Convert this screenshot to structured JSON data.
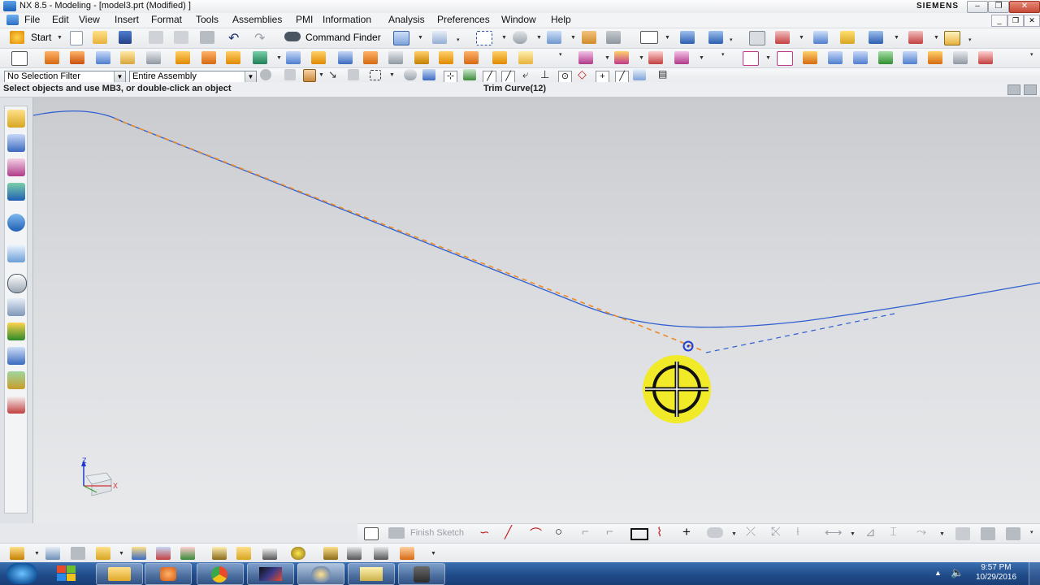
{
  "window": {
    "title": "NX 8.5 - Modeling - [model3.prt (Modified) ]",
    "brand": "SIEMENS",
    "controls": {
      "minimize": "–",
      "restore": "❐",
      "close": "✕"
    }
  },
  "menubar": {
    "items": [
      "File",
      "Edit",
      "View",
      "Insert",
      "Format",
      "Tools",
      "Assemblies",
      "PMI",
      "Information",
      "Analysis",
      "Preferences",
      "Window",
      "Help"
    ]
  },
  "standard_toolbar": {
    "start_label": "Start",
    "command_finder_label": "Command Finder"
  },
  "selection_bar": {
    "filter_value": "No Selection Filter",
    "scope_value": "Entire Assembly"
  },
  "status_line": {
    "prompt": "Select objects and use MB3, or double-click an object",
    "status": "Trim Curve(12)"
  },
  "sketch_toolbar": {
    "finish_sketch_label": "Finish Sketch"
  },
  "triad": {
    "x_label": "X",
    "z_label": "Z"
  },
  "taskbar": {
    "time": "9:57 PM",
    "date": "10/29/2016"
  },
  "colors": {
    "curve": "#2f5fd0",
    "trim_dash": "#f08a24",
    "cursor_highlight": "#f2ea18"
  },
  "icons": {
    "resource_bar": [
      "assembly-navigator-icon",
      "constraint-navigator-icon",
      "part-navigator-icon",
      "reuse-library-icon",
      "hd3d-tools-icon",
      "web-browser-icon",
      "history-icon",
      "process-studio-icon",
      "manufacturing-wizard-icon",
      "roles-icon",
      "system-scenes-icon",
      "palette-icon"
    ]
  }
}
